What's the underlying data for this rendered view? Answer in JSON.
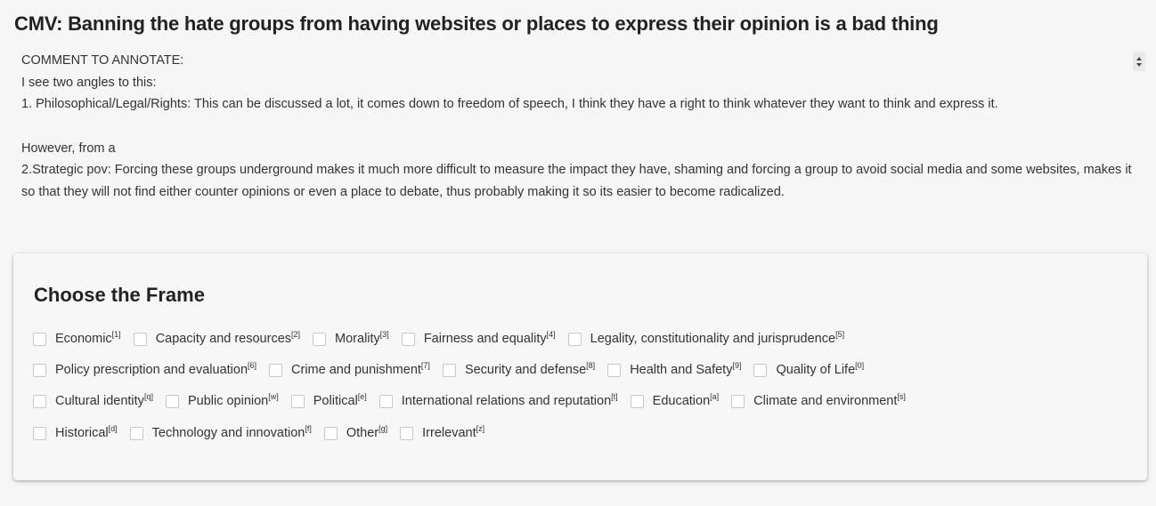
{
  "header": {
    "title": "CMV: Banning the hate groups from having websites or places to express their opinion is a bad thing"
  },
  "comment": {
    "label": "COMMENT TO ANNOTATE:",
    "lines": [
      "I see two angles to this:",
      "1. Philosophical/Legal/Rights: This can be discussed a lot, it comes down to freedom of speech, I think they have a right to think whatever they want to think and express it.",
      "",
      "However, from a",
      "2.Strategic pov: Forcing these groups underground makes it much more difficult to measure the impact they have, shaming and forcing a group to avoid social media and some websites, makes it so that they will not find either counter opinions or even a place to debate, thus probably making it so its easier to become radicalized."
    ]
  },
  "frame_card": {
    "title": "Choose the Frame",
    "rows": [
      [
        {
          "label": "Economic",
          "key": "[1]",
          "checked": false
        },
        {
          "label": "Capacity and resources",
          "key": "[2]",
          "checked": false
        },
        {
          "label": "Morality",
          "key": "[3]",
          "checked": false
        },
        {
          "label": "Fairness and equality",
          "key": "[4]",
          "checked": false
        },
        {
          "label": "Legality, constitutionality and jurisprudence",
          "key": "[5]",
          "checked": false
        }
      ],
      [
        {
          "label": "Policy prescription and evaluation",
          "key": "[6]",
          "checked": false
        },
        {
          "label": "Crime and punishment",
          "key": "[7]",
          "checked": false
        },
        {
          "label": "Security and defense",
          "key": "[8]",
          "checked": false
        },
        {
          "label": "Health and Safety",
          "key": "[9]",
          "checked": false
        },
        {
          "label": "Quality of Life",
          "key": "[0]",
          "checked": false
        }
      ],
      [
        {
          "label": "Cultural identity",
          "key": "[q]",
          "checked": false
        },
        {
          "label": "Public opinion",
          "key": "[w]",
          "checked": false
        },
        {
          "label": "Political",
          "key": "[e]",
          "checked": false
        },
        {
          "label": "International relations and reputation",
          "key": "[t]",
          "checked": false
        },
        {
          "label": "Education",
          "key": "[a]",
          "checked": false
        },
        {
          "label": "Climate and environment",
          "key": "[s]",
          "checked": false
        }
      ],
      [
        {
          "label": "Historical",
          "key": "[d]",
          "checked": false
        },
        {
          "label": "Technology and innovation",
          "key": "[f]",
          "checked": false
        },
        {
          "label": "Other",
          "key": "[g]",
          "checked": false
        },
        {
          "label": "Irrelevant",
          "key": "[z]",
          "checked": false
        }
      ]
    ]
  },
  "colors": {
    "background": "#f6f6f6",
    "card": "#f7f7f7",
    "checkbox_border": "#c8c8c8",
    "text": "#333333"
  },
  "icons": {
    "scroll_spinner": "up-down-arrows-icon"
  }
}
